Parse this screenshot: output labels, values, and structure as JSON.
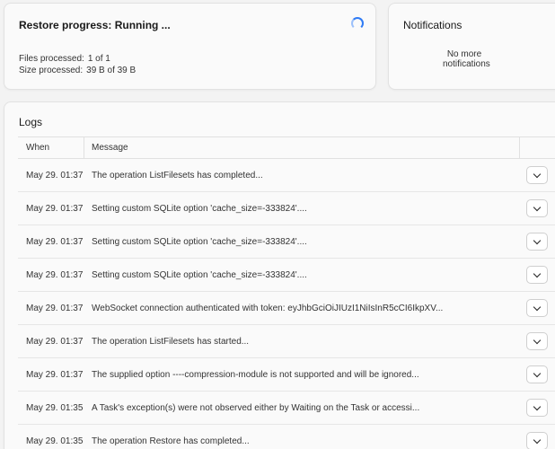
{
  "restore": {
    "title": "Restore progress: Running ...",
    "files_label": "Files processed:",
    "files_value": "1 of 1",
    "size_label": "Size processed:",
    "size_value": "39 B of 39 B"
  },
  "notifications": {
    "title": "Notifications",
    "empty_text": "No more notifications"
  },
  "logs": {
    "title": "Logs",
    "columns": {
      "when": "When",
      "message": "Message"
    },
    "rows": [
      {
        "when": "May 29. 01:37",
        "message": "The operation ListFilesets has completed..."
      },
      {
        "when": "May 29. 01:37",
        "message": "Setting custom SQLite option 'cache_size=-333824'...."
      },
      {
        "when": "May 29. 01:37",
        "message": "Setting custom SQLite option 'cache_size=-333824'...."
      },
      {
        "when": "May 29. 01:37",
        "message": "Setting custom SQLite option 'cache_size=-333824'...."
      },
      {
        "when": "May 29. 01:37",
        "message": "WebSocket connection authenticated with token: eyJhbGciOiJIUzI1NiIsInR5cCI6IkpXV..."
      },
      {
        "when": "May 29. 01:37",
        "message": "The operation ListFilesets has started..."
      },
      {
        "when": "May 29. 01:37",
        "message": "The supplied option ----compression-module is not supported and will be ignored..."
      },
      {
        "when": "May 29. 01:35",
        "message": "A Task's exception(s) were not observed either by Waiting on the Task or accessi..."
      },
      {
        "when": "May 29. 01:35",
        "message": "The operation Restore has completed..."
      }
    ]
  },
  "icons": {
    "spinner": "loading-spinner-icon",
    "expand": "chevron-down-icon"
  },
  "colors": {
    "spinner": "#2f7bf5",
    "card_bg": "#fafafa",
    "page_bg": "#f3f3f3"
  }
}
